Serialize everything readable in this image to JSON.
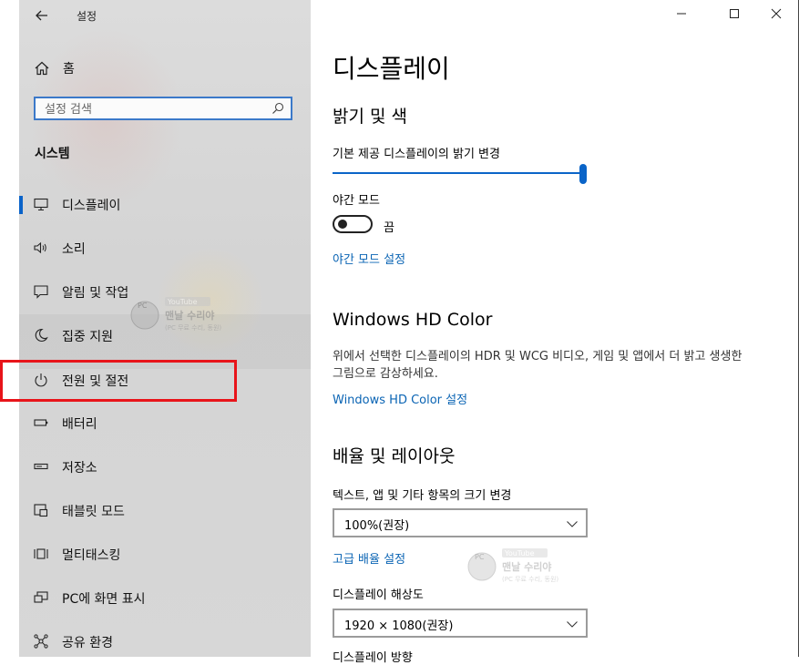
{
  "window": {
    "title": "설정",
    "minimize": "—",
    "maximize": "☐",
    "close": "✕"
  },
  "sidebar": {
    "home": "홈",
    "search_placeholder": "설정 검색",
    "section": "시스템",
    "items": [
      {
        "label": "디스플레이",
        "icon": "monitor-icon",
        "selected": true
      },
      {
        "label": "소리",
        "icon": "speaker-icon"
      },
      {
        "label": "알림 및 작업",
        "icon": "notification-icon"
      },
      {
        "label": "집중 지원",
        "icon": "moon-icon"
      },
      {
        "label": "전원 및 절전",
        "icon": "power-icon"
      },
      {
        "label": "배터리",
        "icon": "battery-icon"
      },
      {
        "label": "저장소",
        "icon": "storage-icon"
      },
      {
        "label": "태블릿 모드",
        "icon": "tablet-icon"
      },
      {
        "label": "멀티태스킹",
        "icon": "multitasking-icon"
      },
      {
        "label": "PC에 화면 표시",
        "icon": "project-icon"
      },
      {
        "label": "공유 환경",
        "icon": "share-icon"
      }
    ]
  },
  "content": {
    "page_title": "디스플레이",
    "brightness_section": "밝기 및 색",
    "brightness_label": "기본 제공 디스플레이의 밝기 변경",
    "brightness_value": 1.0,
    "night_light_label": "야간 모드",
    "night_light_state": "끔",
    "night_light_link": "야간 모드 설정",
    "hdr_section": "Windows HD Color",
    "hdr_description": "위에서 선택한 디스플레이의 HDR 및 WCG 비디오, 게임 및 앱에서 더 밝고 생생한 그림으로 감상하세요.",
    "hdr_link": "Windows HD Color 설정",
    "layout_section": "배율 및 레이아웃",
    "scale_label": "텍스트, 앱 및 기타 항목의 크기 변경",
    "scale_value": "100%(권장)",
    "advanced_scale_link": "고급 배율 설정",
    "resolution_label": "디스플레이 해상도",
    "resolution_value": "1920 × 1080(권장)",
    "orientation_label": "디스플레이 방향"
  },
  "watermark": {
    "top": "YouTube",
    "name": "맨날 수리야",
    "sub": "(PC 무료 수리, 동원)",
    "logo": "PC"
  }
}
